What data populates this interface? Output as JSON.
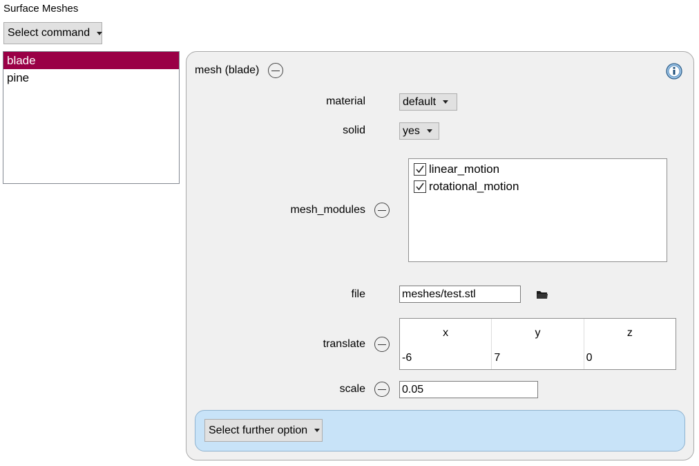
{
  "header": {
    "title": "Surface Meshes",
    "select_command": "Select command"
  },
  "mesh_list": {
    "items": [
      "blade",
      "pine"
    ],
    "selected_index": 0
  },
  "panel": {
    "title": "mesh (blade)",
    "fields": {
      "material": {
        "label": "material",
        "value": "default"
      },
      "solid": {
        "label": "solid",
        "value": "yes"
      },
      "mesh_modules": {
        "label": "mesh_modules",
        "items": [
          {
            "name": "linear_motion",
            "checked": true
          },
          {
            "name": "rotational_motion",
            "checked": true
          }
        ]
      },
      "file": {
        "label": "file",
        "value": "meshes/test.stl"
      },
      "translate": {
        "label": "translate",
        "columns": [
          "x",
          "y",
          "z"
        ],
        "values": [
          "-6",
          "7",
          "0"
        ]
      },
      "scale": {
        "label": "scale",
        "value": "0.05"
      }
    },
    "further_option": "Select further option"
  },
  "icons": {
    "info": "info-icon",
    "remove": "minus-circle-icon",
    "folder": "folder-icon",
    "checkbox": "checkbox-icon"
  },
  "colors": {
    "selection": "#9a0046",
    "panel_bg": "#f0f0f0",
    "further_bg": "#c8e3f8"
  }
}
